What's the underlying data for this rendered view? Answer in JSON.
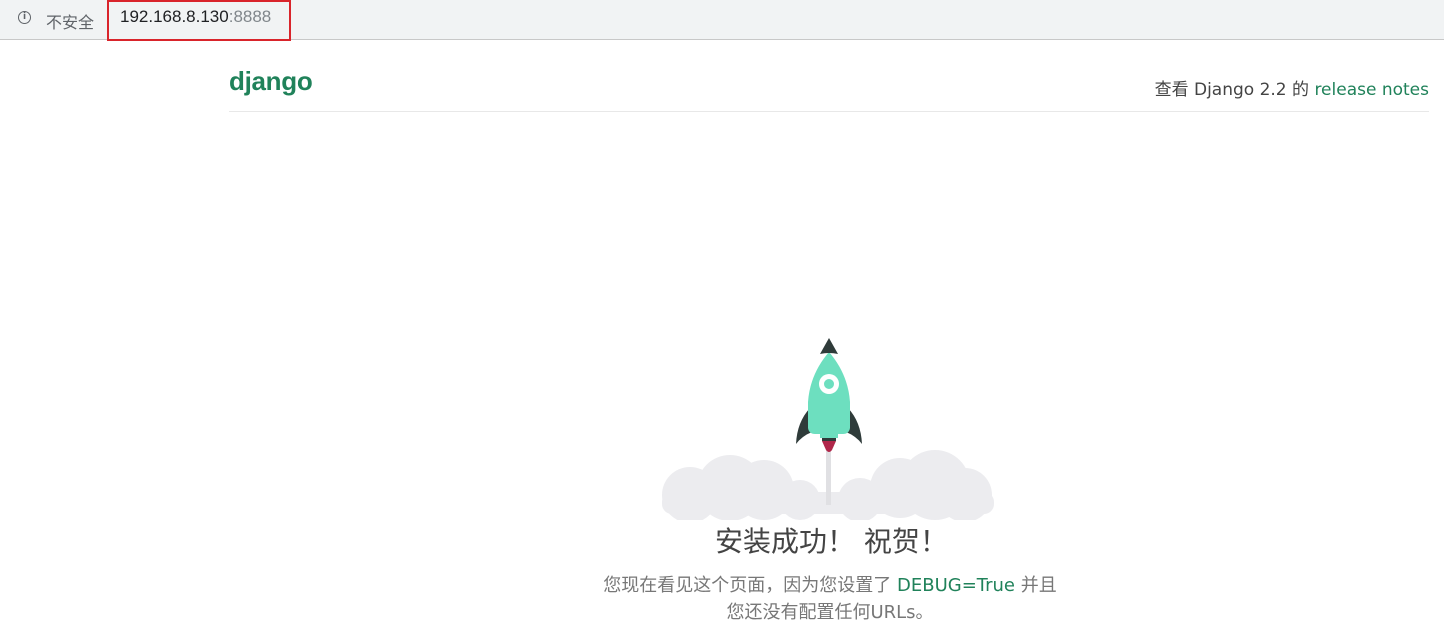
{
  "browser": {
    "security_label": "不安全",
    "security_icon": "info-icon",
    "url_host": "192.168.8.130",
    "url_port": ":8888",
    "highlight_color": "#d9242b"
  },
  "header": {
    "logo": "django",
    "release_prefix": "查看 Django 2.2 的 ",
    "release_link": "release notes"
  },
  "main": {
    "illustration": "rocket-launch-icon",
    "title": "安装成功！ 祝贺！",
    "desc_part1": "您现在看见这个页面，因为您设置了 ",
    "desc_highlight": "DEBUG=True",
    "desc_part2": " 并且",
    "desc_line2": "您还没有配置任何URLs。"
  },
  "colors": {
    "brand": "#20825a",
    "rocket": "#6ddfbf",
    "cloud": "#ececef"
  }
}
